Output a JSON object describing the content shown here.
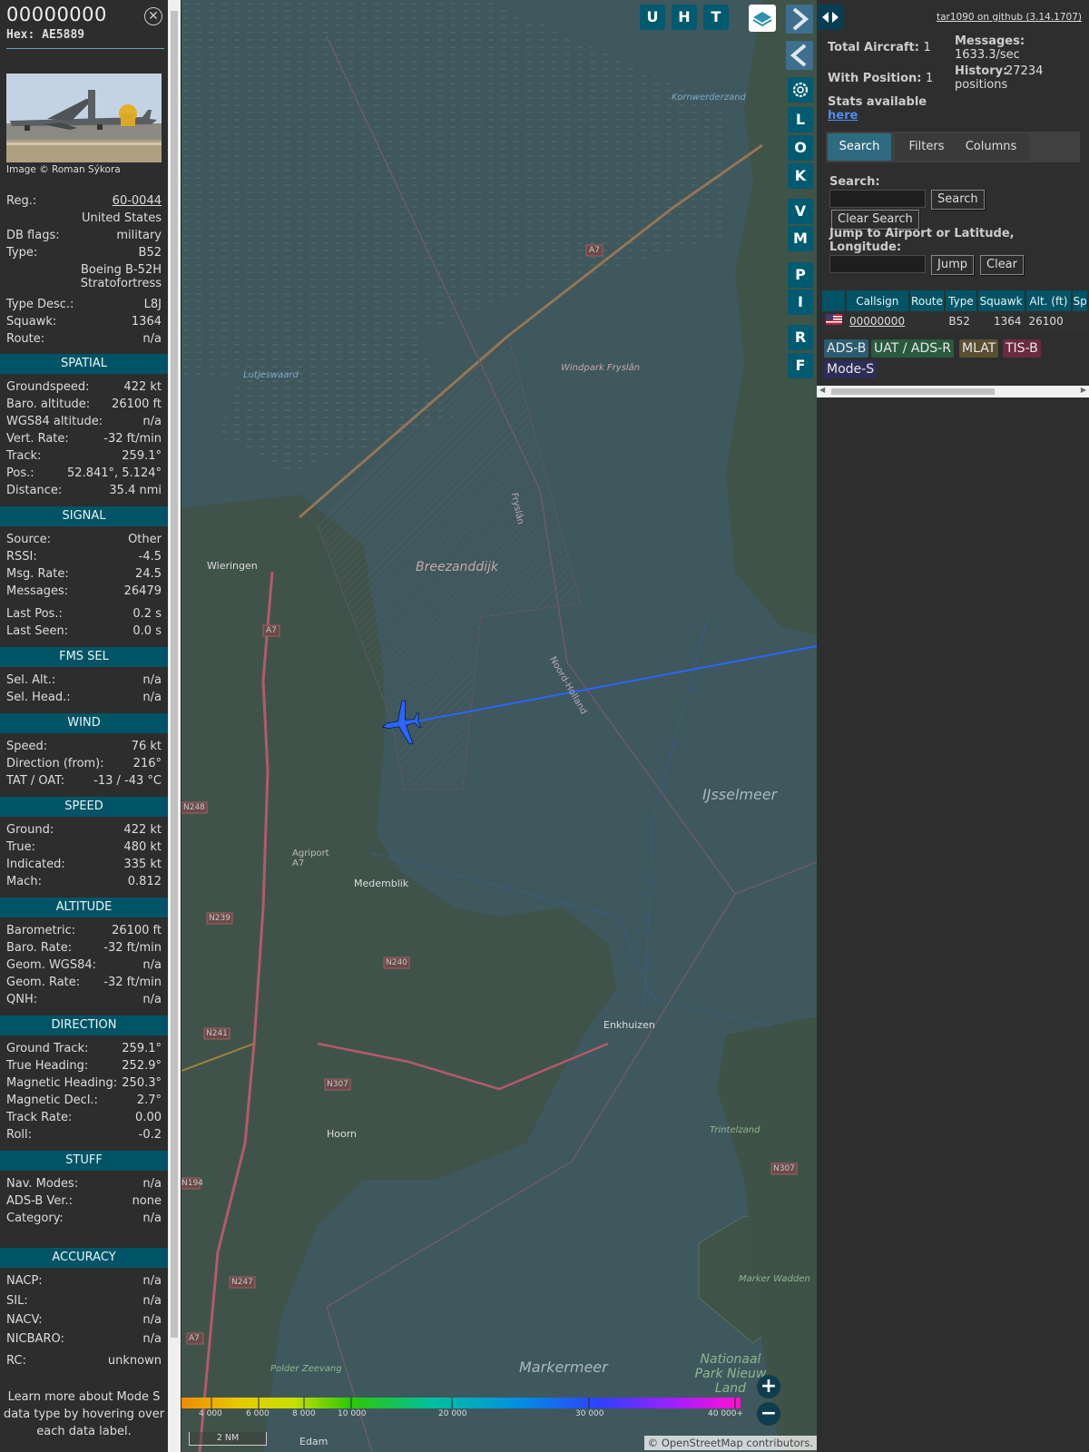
{
  "info": {
    "callsign": "00000000",
    "hex": "Hex: AE5889",
    "close_icon": "x-circle-icon",
    "image_credit": "Image © Roman Sýkora",
    "fields": [
      {
        "k": "Reg.:",
        "v": "60-0044"
      },
      {
        "k": "",
        "v": "United States"
      },
      {
        "k": "DB flags:",
        "v": "military"
      },
      {
        "k": "Type:",
        "v": "B52"
      },
      {
        "k": "",
        "v": "Boeing B-52H"
      },
      {
        "k": "",
        "v": "Stratofortress"
      },
      {
        "k": "Type Desc.:",
        "v": "L8J"
      },
      {
        "k": "Squawk:",
        "v": "1364"
      },
      {
        "k": "Route:",
        "v": "n/a"
      }
    ],
    "sections": [
      {
        "title": "SPATIAL",
        "rows": [
          {
            "k": "Groundspeed:",
            "v": "422 kt"
          },
          {
            "k": "Baro. altitude:",
            "v": "26100 ft"
          },
          {
            "k": "WGS84 altitude:",
            "v": "n/a"
          },
          {
            "k": "Vert. Rate:",
            "v": "-32 ft/min"
          },
          {
            "k": "Track:",
            "v": "259.1°"
          },
          {
            "k": "Pos.:",
            "v": "52.841°, 5.124°"
          },
          {
            "k": "Distance:",
            "v": "35.4 nmi"
          }
        ]
      },
      {
        "title": "SIGNAL",
        "rows": [
          {
            "k": "Source:",
            "v": "Other"
          },
          {
            "k": "RSSI:",
            "v": "-4.5"
          },
          {
            "k": "Msg. Rate:",
            "v": "24.5"
          },
          {
            "k": "Messages:",
            "v": "26479"
          },
          {
            "k": "Last Pos.:",
            "v": "0.2 s"
          },
          {
            "k": "Last Seen:",
            "v": "0.0 s"
          }
        ]
      },
      {
        "title": "FMS SEL",
        "rows": [
          {
            "k": "Sel. Alt.:",
            "v": "n/a"
          },
          {
            "k": "Sel. Head.:",
            "v": "n/a"
          }
        ]
      },
      {
        "title": "WIND",
        "rows": [
          {
            "k": "Speed:",
            "v": "76 kt"
          },
          {
            "k": "Direction (from):",
            "v": "216°"
          },
          {
            "k": "TAT / OAT:",
            "v": "-13 / -43 °C"
          }
        ]
      },
      {
        "title": "SPEED",
        "rows": [
          {
            "k": "Ground:",
            "v": "422 kt"
          },
          {
            "k": "True:",
            "v": "480 kt"
          },
          {
            "k": "Indicated:",
            "v": "335 kt"
          },
          {
            "k": "Mach:",
            "v": "0.812"
          }
        ]
      },
      {
        "title": "ALTITUDE",
        "rows": [
          {
            "k": "Barometric:",
            "v": "26100 ft"
          },
          {
            "k": "Baro. Rate:",
            "v": "-32 ft/min"
          },
          {
            "k": "Geom. WGS84:",
            "v": "n/a"
          },
          {
            "k": "Geom. Rate:",
            "v": "-32 ft/min"
          },
          {
            "k": "QNH:",
            "v": "n/a"
          }
        ]
      },
      {
        "title": "DIRECTION",
        "rows": [
          {
            "k": "Ground Track:",
            "v": "259.1°"
          },
          {
            "k": "True Heading:",
            "v": "252.9°"
          },
          {
            "k": "Magnetic Heading:",
            "v": "250.3°"
          },
          {
            "k": "Magnetic Decl.:",
            "v": "2.7°"
          },
          {
            "k": "Track Rate:",
            "v": "0.00"
          },
          {
            "k": "Roll:",
            "v": "-0.2"
          }
        ]
      },
      {
        "title": "STUFF",
        "rows": [
          {
            "k": "Nav. Modes:",
            "v": "n/a"
          },
          {
            "k": "ADS-B Ver.:",
            "v": "none"
          },
          {
            "k": "Category:",
            "v": "n/a"
          }
        ]
      },
      {
        "title": "ACCURACY",
        "rows": [
          {
            "k": "NACP:",
            "v": "n/a"
          },
          {
            "k": "SIL:",
            "v": "n/a"
          },
          {
            "k": "NACV:",
            "v": "n/a"
          },
          {
            "k": "NICBARO:",
            "v": "n/a"
          },
          {
            "k": "RC:",
            "v": "unknown"
          }
        ]
      }
    ],
    "note": "Learn more about Mode S data type by hovering over each data label."
  },
  "map": {
    "top_buttons": [
      "U",
      "H",
      "T"
    ],
    "layers_icon": "layers-icon",
    "side_buttons": [
      "L",
      "O",
      "K",
      "V",
      "M",
      "P",
      "I",
      "R",
      "F"
    ],
    "expand_icon": "chevron-right-icon",
    "collapse_icon": "chevron-left-icon",
    "settings_icon": "gear-icon",
    "zoom_in": "+",
    "zoom_out": "−",
    "altitude_scale": [
      "4 000",
      "6 000",
      "8 000",
      "10 000",
      "20 000",
      "30 000",
      "40 000+"
    ],
    "scale_bar": "2 NM",
    "attribution_prefix": "© ",
    "attribution_link": "OpenStreetMap",
    "attribution_suffix": " contributors.",
    "places": [
      "Breezanddijk",
      "IJsselmeer",
      "Markermeer",
      "Wieringen",
      "Medemblik",
      "Enkhuizen",
      "Hoorn",
      "Lutjeswaard",
      "Windpark Fryslân",
      "Kornwerderzand",
      "Trintelzand",
      "Marker Wadden",
      "Nationaal Park Nieuw Land",
      "Edam",
      "Agriport A7",
      "Polder Zeevang",
      "Fryslân",
      "Noord-Holland"
    ],
    "roads": [
      "A7",
      "N248",
      "N239",
      "N240",
      "N241",
      "N307",
      "N247",
      "N194"
    ],
    "colors": {
      "track": "#2a66ff",
      "aircraft": "#2a66ff"
    }
  },
  "right": {
    "panel_toggle_icon": "left-right-arrows-icon",
    "version_link": "tar1090 on github (3.14.1707)",
    "total_label": "Total Aircraft:",
    "total_value": "1",
    "pos_label": "With Position:",
    "pos_value": "1",
    "stats_label": "Stats available",
    "stats_link": "here",
    "messages_label": "Messages:",
    "messages_value": "1633.3/sec",
    "history_label": "History:",
    "history_value": "27234 positions",
    "tabs": [
      "Search",
      "Filters",
      "Columns"
    ],
    "search_label": "Search:",
    "search_button": "Search",
    "clear_search": "Clear Search",
    "jump_label": "Jump to Airport or Latitude, Longitude:",
    "jump_button": "Jump",
    "clear_button": "Clear",
    "table": {
      "headers": [
        "",
        "Callsign",
        "Route",
        "Type",
        "Squawk",
        "Alt. (ft)",
        "Sp"
      ],
      "rows": [
        {
          "flag": "us-flag-icon",
          "callsign": "00000000",
          "route": "",
          "type": "B52",
          "squawk": "1364",
          "alt": "26100",
          "sp": ""
        }
      ]
    },
    "legend": [
      "ADS-B",
      "UAT / ADS-R",
      "MLAT",
      "TIS-B",
      "Mode-S"
    ]
  }
}
